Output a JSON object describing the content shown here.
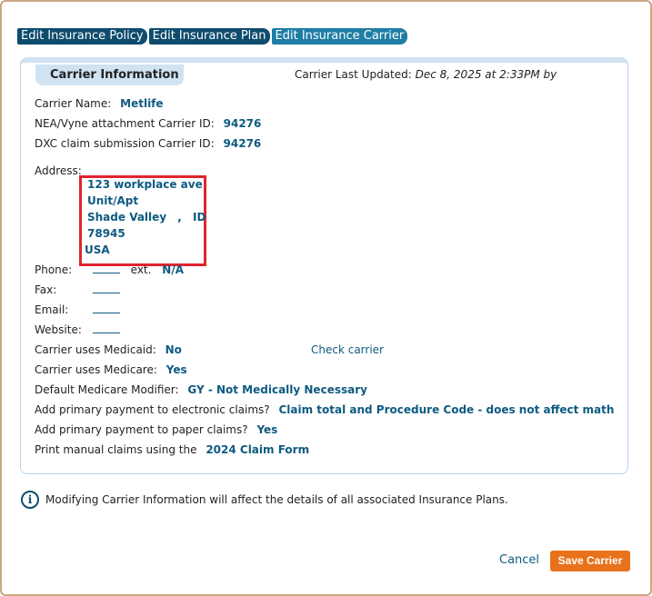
{
  "tabs": [
    {
      "label": "Edit Insurance Policy"
    },
    {
      "label": "Edit Insurance Plan"
    },
    {
      "label": "Edit Insurance Carrier"
    }
  ],
  "panel": {
    "title": "Carrier Information",
    "last_updated_label": "Carrier Last Updated:",
    "last_updated_value": "Dec 8, 2025 at 2:33PM by"
  },
  "fields": {
    "carrier_name": {
      "label": "Carrier Name:",
      "value": "Metlife"
    },
    "nea_id": {
      "label": "NEA/Vyne attachment Carrier ID:",
      "value": "94276"
    },
    "dxc_id": {
      "label": "DXC claim submission Carrier ID:",
      "value": "94276"
    },
    "address_label": "Address:",
    "address": {
      "line1": "123 workplace ave",
      "line2": "Unit/Apt",
      "city": "Shade Valley",
      "sep": ",",
      "state": "ID",
      "zip": "78945",
      "country": "USA"
    },
    "phone": {
      "label": "Phone:",
      "ext_label": "ext.",
      "ext_value": "N/A"
    },
    "fax": {
      "label": "Fax:"
    },
    "email": {
      "label": "Email:"
    },
    "website": {
      "label": "Website:"
    },
    "medicaid": {
      "label": "Carrier uses Medicaid:",
      "value": "No",
      "link": "Check carrier"
    },
    "medicare": {
      "label": "Carrier uses Medicare:",
      "value": "Yes"
    },
    "modifier": {
      "label": "Default Medicare Modifier:",
      "value": "GY - Not Medically Necessary"
    },
    "primary_electronic": {
      "label": "Add primary payment to electronic claims?",
      "value": "Claim total and Procedure Code - does not affect math"
    },
    "primary_paper": {
      "label": "Add primary payment to paper claims?",
      "value": "Yes"
    },
    "manual_claims": {
      "label": "Print manual claims using the",
      "value": "2024 Claim Form"
    }
  },
  "info_message": "Modifying Carrier Information will affect the details of all associated Insurance Plans.",
  "buttons": {
    "cancel": "Cancel",
    "save": "Save Carrier"
  }
}
